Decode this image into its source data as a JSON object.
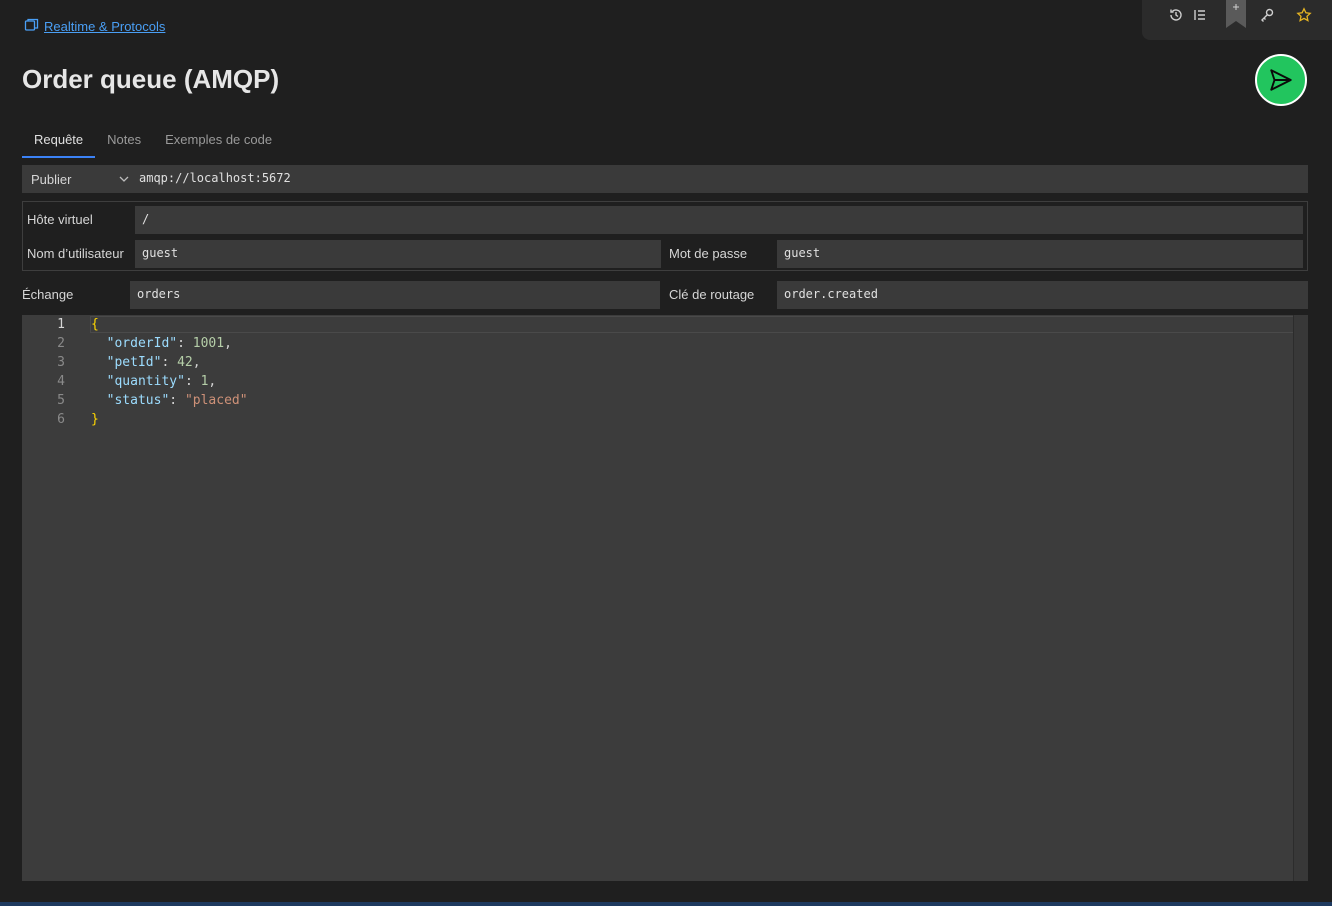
{
  "breadcrumb": {
    "label": "Realtime & Protocols"
  },
  "title": "Order queue (AMQP)",
  "tabs": [
    {
      "label": "Requête",
      "active": true
    },
    {
      "label": "Notes",
      "active": false
    },
    {
      "label": "Exemples de code",
      "active": false
    }
  ],
  "request": {
    "method": "Publier",
    "url": "amqp://localhost:5672"
  },
  "auth": {
    "vhost_label": "Hôte virtuel",
    "vhost_value": "/",
    "username_label": "Nom d’utilisateur",
    "username_value": "guest",
    "password_label": "Mot de passe",
    "password_value": "guest"
  },
  "routing": {
    "exchange_label": "Échange",
    "exchange_value": "orders",
    "routing_key_label": "Clé de routage",
    "routing_key_value": "order.created"
  },
  "editor": {
    "line_numbers": [
      "1",
      "2",
      "3",
      "4",
      "5",
      "6"
    ],
    "lines": [
      "{",
      "  \"orderId\": 1001,",
      "  \"petId\": 42,",
      "  \"quantity\": 1,",
      "  \"status\": \"placed\"",
      "}"
    ]
  },
  "colors": {
    "accent": "#3b82f6",
    "send_button": "#22c55e",
    "link": "#4a9ff5"
  },
  "icons": [
    "history-icon",
    "list-icon",
    "bookmark-icon",
    "key-icon",
    "star-icon",
    "send-icon",
    "collection-icon",
    "chevron-down-icon"
  ]
}
